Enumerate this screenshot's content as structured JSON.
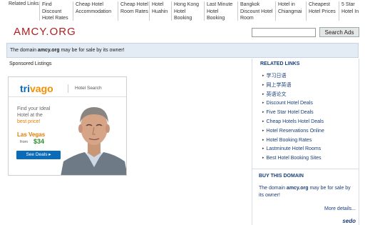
{
  "topbar": {
    "label": "Related Links:",
    "links": [
      {
        "line1": "Find Discount",
        "line2": "Hotel Rates",
        "line3": ""
      },
      {
        "line1": "Cheap Hotel",
        "line2": "Accommodation",
        "line3": ""
      },
      {
        "line1": "Cheap Hotel",
        "line2": "Room Rates",
        "line3": ""
      },
      {
        "line1": "Hotel",
        "line2": "Huahin",
        "line3": ""
      },
      {
        "line1": "Hong Kong",
        "line2": "Hotel Booking",
        "line3": ""
      },
      {
        "line1": "Last Minute",
        "line2": "Hotel Booking",
        "line3": ""
      },
      {
        "line1": "Bangkok",
        "line2": "Discount Hotel",
        "line3": "Room"
      },
      {
        "line1": "Hotel in",
        "line2": "Chiangmai",
        "line3": ""
      },
      {
        "line1": "Cheapest",
        "line2": "Hotel Prices",
        "line3": ""
      },
      {
        "line1": "5 Star",
        "line2": "Hotel In",
        "line3": ""
      }
    ]
  },
  "header": {
    "logo": "AMCY.ORG",
    "search_placeholder": "",
    "search_button": "Search Ads"
  },
  "banner": {
    "prefix": "The domain ",
    "domain": "amcy.org",
    "suffix": " may be for sale by its owner!"
  },
  "left": {
    "sponsored": "Sponsored Listings",
    "ad": {
      "brand_a": "tri",
      "brand_b": "vago",
      "tagline": "Hotel Search",
      "copy1": "Find your Ideal",
      "copy2": "Hotel at the",
      "copy3": "best price!",
      "city": "Las Vegas",
      "from": "from",
      "price": "$34",
      "cta": "See Deals ▸"
    }
  },
  "related": {
    "title": "RELATED LINKS",
    "items": [
      "学习日语",
      "网上学英语",
      "英语论文",
      "Discount Hotel Deals",
      "Five Star Hotel Deals",
      "Cheap Hotels Hotel Deals",
      "Hotel Reservations Online",
      "Hotel Booking Rates",
      "Lastminute Hotel Rooms",
      "Best Hotel Booking Sites"
    ]
  },
  "buy": {
    "title": "BUY THIS DOMAIN",
    "prefix": "The domain ",
    "domain": "amcy.org",
    "suffix": " may be for sale by its owner!",
    "more": "More details...",
    "sedo": "sedo"
  }
}
